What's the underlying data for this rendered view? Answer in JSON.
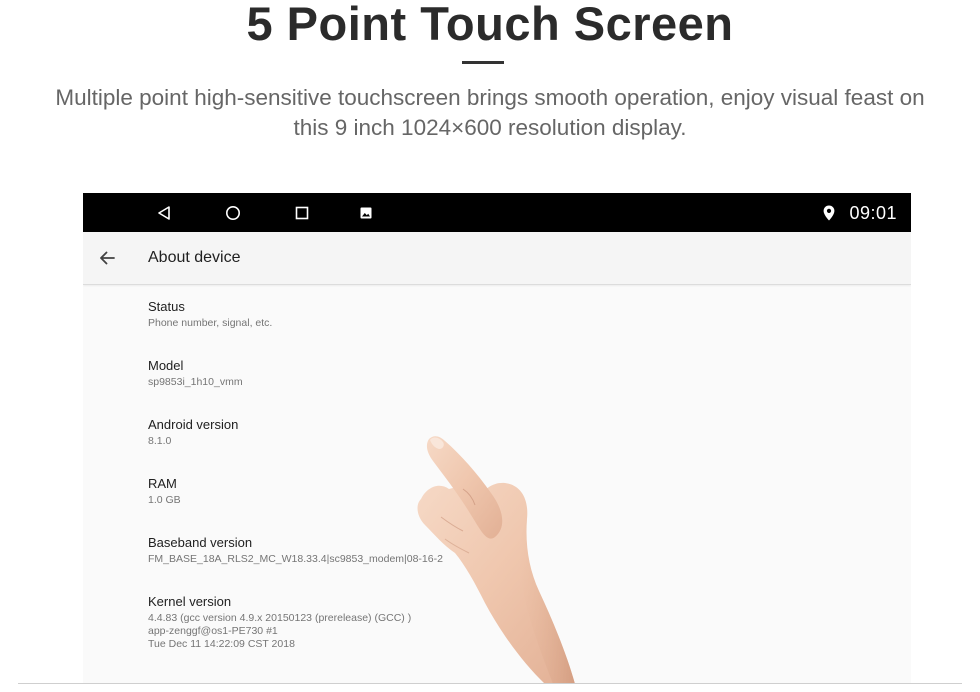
{
  "headline": "5 Point Touch Screen",
  "subhead": {
    "line1": "Multiple point high-sensitive touchscreen brings smooth operation, enjoy visual feast on",
    "line2": "this 9 inch 1024×600 resolution display."
  },
  "statusbar": {
    "nav_icons": [
      "back-icon",
      "home-icon",
      "recents-icon",
      "screenshot-icon"
    ],
    "status_icons": [
      "location-pin-icon"
    ],
    "time": "09:01"
  },
  "appbar": {
    "back_icon": "arrow-left-icon",
    "title": "About device"
  },
  "settings": [
    {
      "label": "Status",
      "summary": "Phone number, signal, etc."
    },
    {
      "label": "Model",
      "summary": "sp9853i_1h10_vmm"
    },
    {
      "label": "Android version",
      "summary": "8.1.0"
    },
    {
      "label": "RAM",
      "summary": "1.0 GB"
    },
    {
      "label": "Baseband version",
      "summary": "FM_BASE_18A_RLS2_MC_W18.33.4|sc9853_modem|08-16-2"
    },
    {
      "label": "Kernel version",
      "summary": "4.4.83 (gcc version 4.9.x 20150123 (prerelease) (GCC) )",
      "summary2": "app-zenggf@os1-PE730 #1",
      "summary3": "Tue Dec 11 14:22:09 CST 2018"
    }
  ],
  "colors": {
    "statusbar": "#000000",
    "appbar": "#f5f5f5",
    "screen_bg": "#fafafa",
    "headline": "#2b2b2b",
    "subhead": "#666666"
  }
}
